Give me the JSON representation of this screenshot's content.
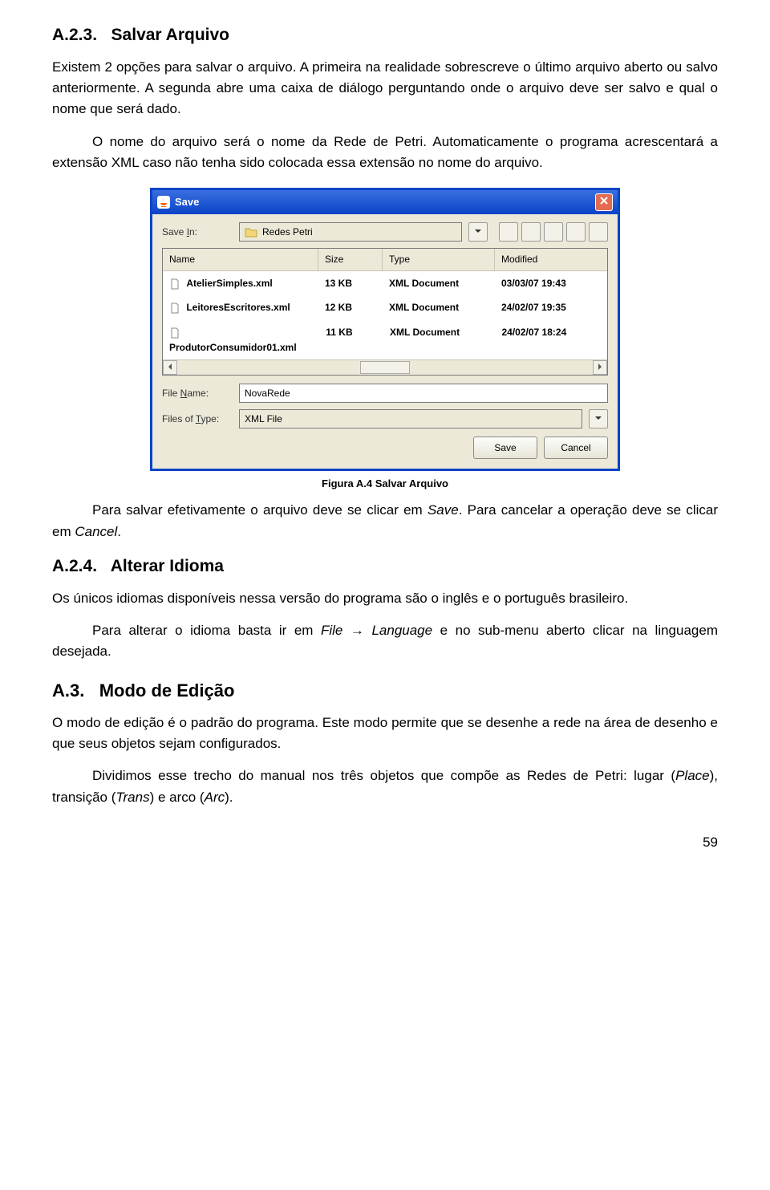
{
  "section1": {
    "number": "A.2.3.",
    "title": "Salvar Arquivo",
    "p1": "Existem 2 opções para salvar o arquivo. A primeira na realidade sobrescreve o último arquivo aberto ou salvo anteriormente. A segunda abre uma caixa de diálogo perguntando onde o arquivo deve ser salvo e qual o nome que será dado.",
    "p2": "O nome do arquivo será o nome da Rede de Petri. Automaticamente o programa acrescentará a extensão XML caso não tenha sido colocada essa extensão no nome do arquivo."
  },
  "dialog": {
    "title": "Save",
    "save_in_label_pre": "Save ",
    "save_in_label_u": "I",
    "save_in_label_post": "n:",
    "save_in_value": "Redes Petri",
    "columns": {
      "name": "Name",
      "size": "Size",
      "type": "Type",
      "modified": "Modified"
    },
    "files": [
      {
        "name": "AtelierSimples.xml",
        "size": "13 KB",
        "type": "XML Document",
        "modified": "03/03/07 19:43"
      },
      {
        "name": "LeitoresEscritores.xml",
        "size": "12 KB",
        "type": "XML Document",
        "modified": "24/02/07 19:35"
      },
      {
        "name": "ProdutorConsumidor01.xml",
        "size": "11 KB",
        "type": "XML Document",
        "modified": "24/02/07 18:24"
      }
    ],
    "file_name_label_pre": "File ",
    "file_name_label_u": "N",
    "file_name_label_post": "ame:",
    "file_name_value": "NovaRede",
    "file_type_label_pre": "Files of ",
    "file_type_label_u": "T",
    "file_type_label_post": "ype:",
    "file_type_value": "XML File",
    "save_button": "Save",
    "cancel_button": "Cancel"
  },
  "fig_caption": "Figura A.4 Salvar Arquivo",
  "after_fig": {
    "p1_a": "Para salvar efetivamente o arquivo deve se clicar em ",
    "p1_save": "Save",
    "p1_b": ". Para cancelar a operação deve se clicar em ",
    "p1_cancel": "Cancel",
    "p1_c": "."
  },
  "section2": {
    "number": "A.2.4.",
    "title": "Alterar Idioma",
    "p1": "Os únicos idiomas disponíveis nessa versão do programa são o inglês e o português brasileiro.",
    "p2_a": "Para alterar o idioma basta ir em ",
    "p2_file": "File",
    "p2_arrow": " → ",
    "p2_lang": "Language",
    "p2_b": " e no sub-menu aberto clicar na linguagem desejada."
  },
  "section3": {
    "number": "A.3.",
    "title": "Modo de Edição",
    "p1": "O modo de edição é o padrão do programa. Este modo permite que se desenhe a rede na área de desenho e que seus objetos sejam configurados.",
    "p2_a": "Dividimos esse trecho do manual nos três objetos que compõe as Redes de Petri: lugar (",
    "p2_place": "Place",
    "p2_b": "), transição (",
    "p2_trans": "Trans",
    "p2_c": ") e arco (",
    "p2_arc": "Arc",
    "p2_d": ")."
  },
  "page_number": "59"
}
